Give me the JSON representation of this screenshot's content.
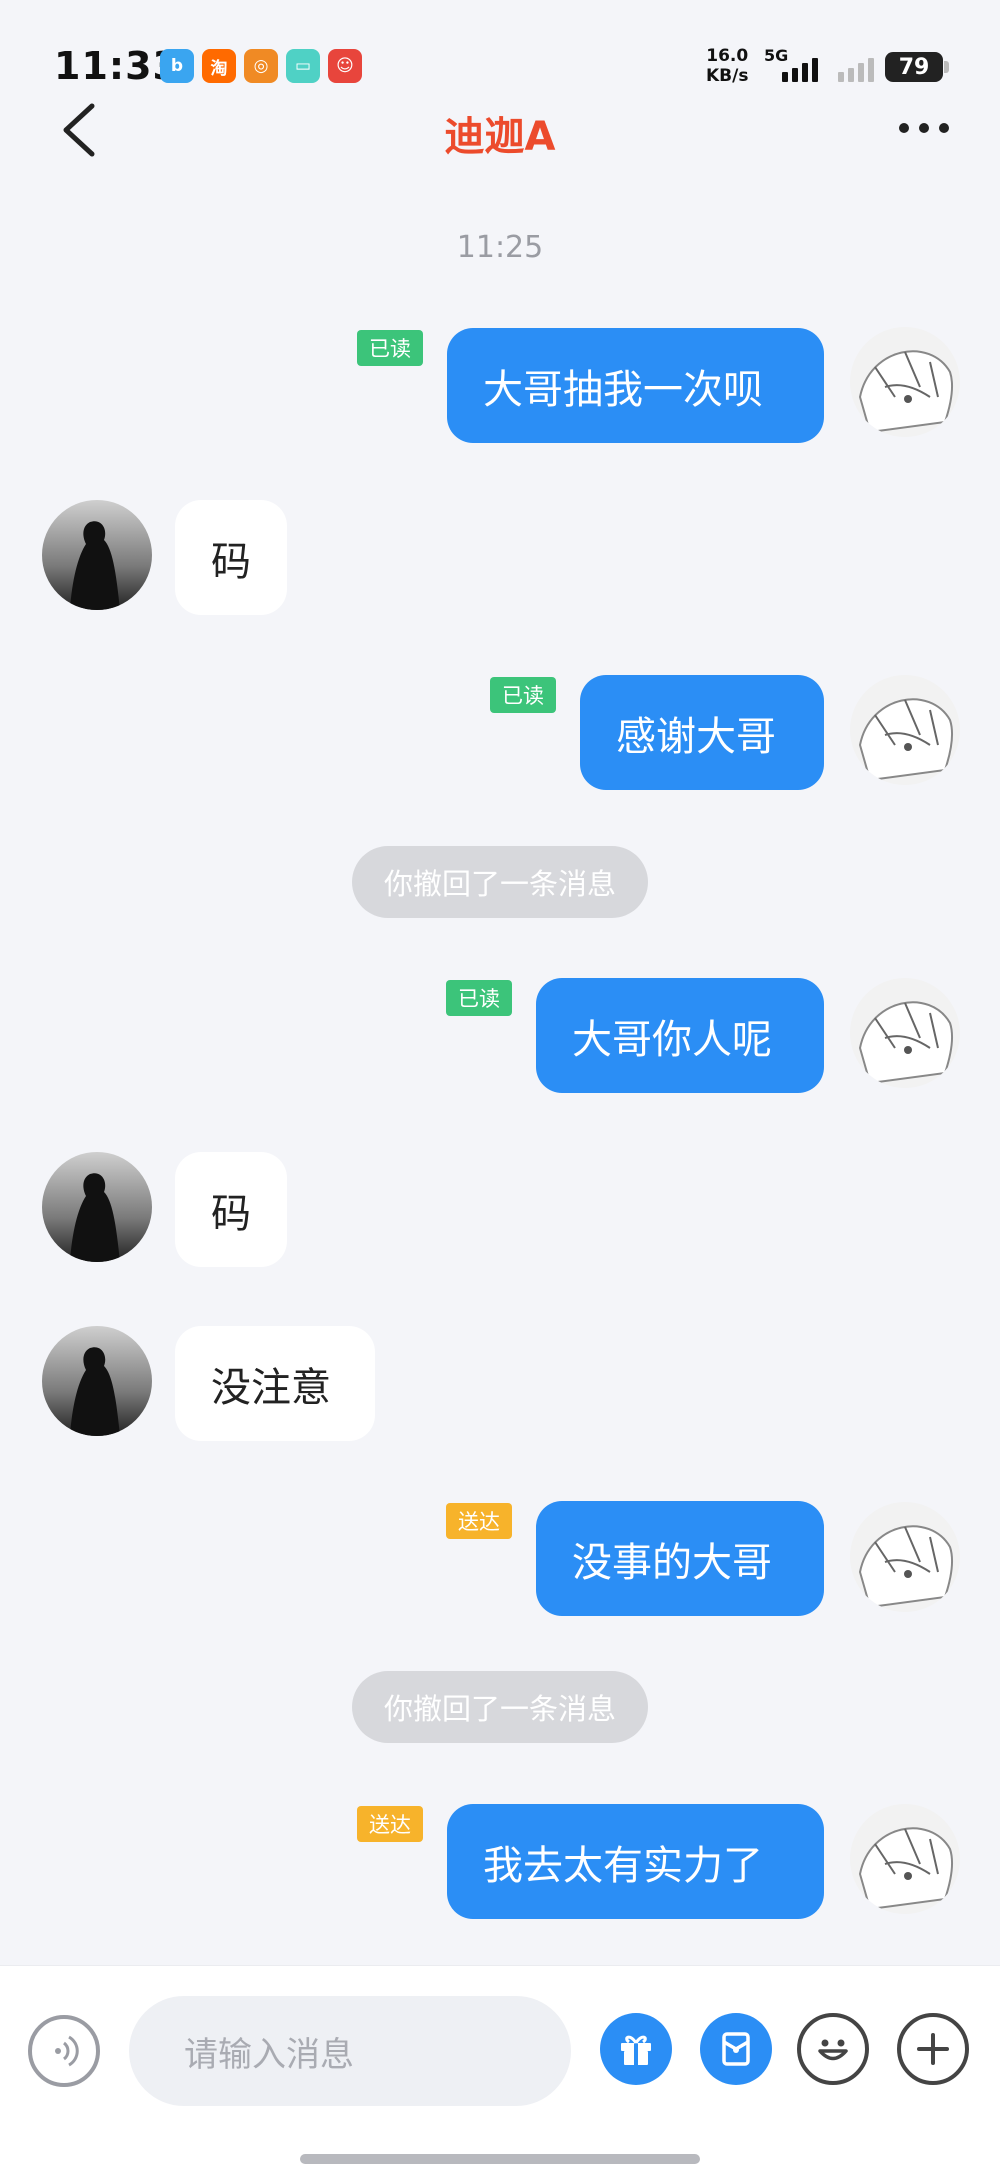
{
  "status_bar": {
    "time": "11:33",
    "speed_value": "16.0",
    "speed_unit": "KB/s",
    "network": "5G",
    "battery": "79",
    "app_icons": [
      {
        "name": "app-icon-blue",
        "glyph": "b",
        "color": "#3aa5f0"
      },
      {
        "name": "taobao-icon",
        "glyph": "淘",
        "color": "#ff6a00"
      },
      {
        "name": "app-icon-orange",
        "glyph": "◎",
        "color": "#f08a24"
      },
      {
        "name": "app-icon-teal",
        "glyph": "▭",
        "color": "#4fd1c5"
      },
      {
        "name": "app-icon-red",
        "glyph": "☺",
        "color": "#e8453c"
      }
    ]
  },
  "header": {
    "title": "迪迦A"
  },
  "chat": {
    "timestamp": "11:25",
    "messages": [
      {
        "from": "me",
        "text": "大哥抽我一次呗",
        "status": "已读"
      },
      {
        "from": "them",
        "text": "码"
      },
      {
        "from": "me",
        "text": "感谢大哥",
        "status": "已读"
      },
      {
        "type": "recall",
        "text": "你撤回了一条消息"
      },
      {
        "from": "me",
        "text": "大哥你人呢",
        "status": "已读"
      },
      {
        "from": "them",
        "text": "码"
      },
      {
        "from": "them",
        "text": "没注意"
      },
      {
        "from": "me",
        "text": "没事的大哥",
        "status": "送达"
      },
      {
        "type": "recall",
        "text": "你撤回了一条消息"
      },
      {
        "from": "me",
        "text": "我去太有实力了",
        "status": "送达"
      }
    ]
  },
  "input_bar": {
    "placeholder": "请输入消息"
  },
  "colors": {
    "accent": "#2b8ef5",
    "title": "#ec4b2c",
    "read_tag": "#3cc47a",
    "sent_tag": "#f7b32b"
  }
}
